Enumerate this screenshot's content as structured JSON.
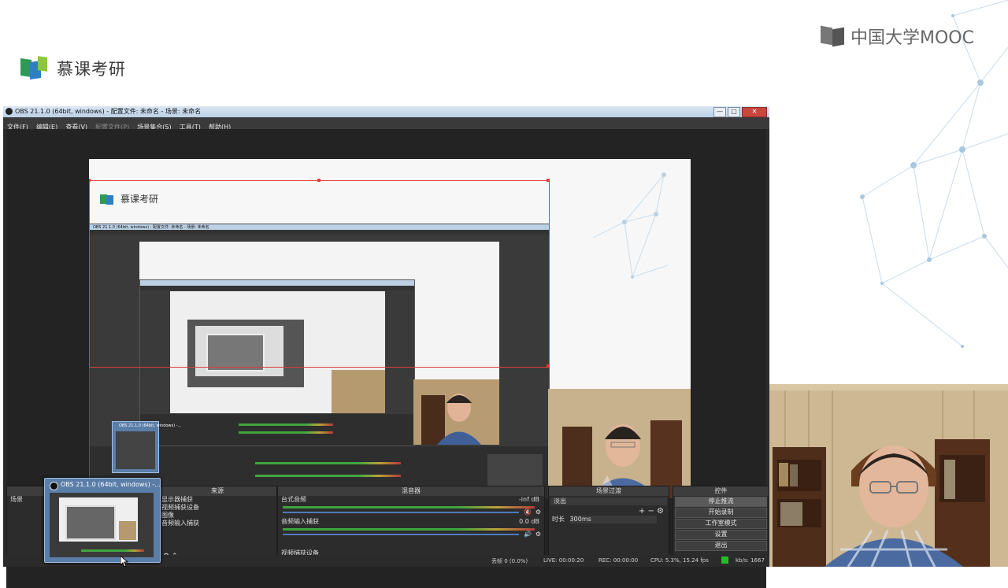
{
  "branding": {
    "left_logo_text": "慕课考研",
    "right_logo_text": "中国大学MOOC"
  },
  "window": {
    "title": "OBS 21.1.0 (64bit, windows) - 配置文件: 未命名 - 场景: 未命名",
    "buttons": {
      "minimize": "—",
      "maximize": "□",
      "close": "✕"
    }
  },
  "menu": [
    {
      "label": "文件(F)",
      "enabled": true
    },
    {
      "label": "编辑(E)",
      "enabled": true
    },
    {
      "label": "查看(V)",
      "enabled": true
    },
    {
      "label": "配置文件(P)",
      "enabled": false
    },
    {
      "label": "场景集合(S)",
      "enabled": true
    },
    {
      "label": "工具(T)",
      "enabled": true
    },
    {
      "label": "帮助(H)",
      "enabled": true
    }
  ],
  "preview": {
    "logo_text": "慕课考研",
    "nested_title": "OBS 21.1.0 (64bit, windows) - 配置文件: 未命名 - 场景: 未命名"
  },
  "docks": {
    "scenes": {
      "header": "场景",
      "items": [
        "场景"
      ]
    },
    "sources": {
      "header": "来源",
      "items": [
        "显示器捕获",
        "视频捕获设备",
        "图像",
        "音频输入捕获"
      ]
    },
    "mixer": {
      "header": "混音器",
      "channels": [
        {
          "name": "台式音频",
          "level": "-inf dB",
          "muted": true
        },
        {
          "name": "音频输入捕获",
          "level": "0.0 dB",
          "muted": false
        },
        {
          "name": "视频捕获设备",
          "level": "",
          "muted": false
        }
      ]
    },
    "transitions": {
      "header": "场景过渡",
      "type": "淡出",
      "duration_label": "时长",
      "duration_value": "300ms"
    },
    "controls": {
      "header": "控件",
      "buttons": [
        "停止推流",
        "开始录制",
        "工作室模式",
        "设置",
        "退出"
      ]
    }
  },
  "status": {
    "dropped": "丢帧 0 (0.0%)",
    "live": "LIVE: 00:00:20",
    "rec": "REC: 00:00:00",
    "cpu": "CPU: 5.3%, 15.24 fps",
    "kbps": "kb/s: 1667"
  },
  "taskbar_thumbnail": {
    "title": "OBS 21.1.0 (64bit, windows) -..."
  },
  "colors": {
    "obs_bg": "#2b2b2b",
    "accent_blue": "#4f7bbd",
    "selection_red": "#e23b3b",
    "logo_green": "#3aa55b",
    "logo_blue": "#2f7fc1"
  }
}
